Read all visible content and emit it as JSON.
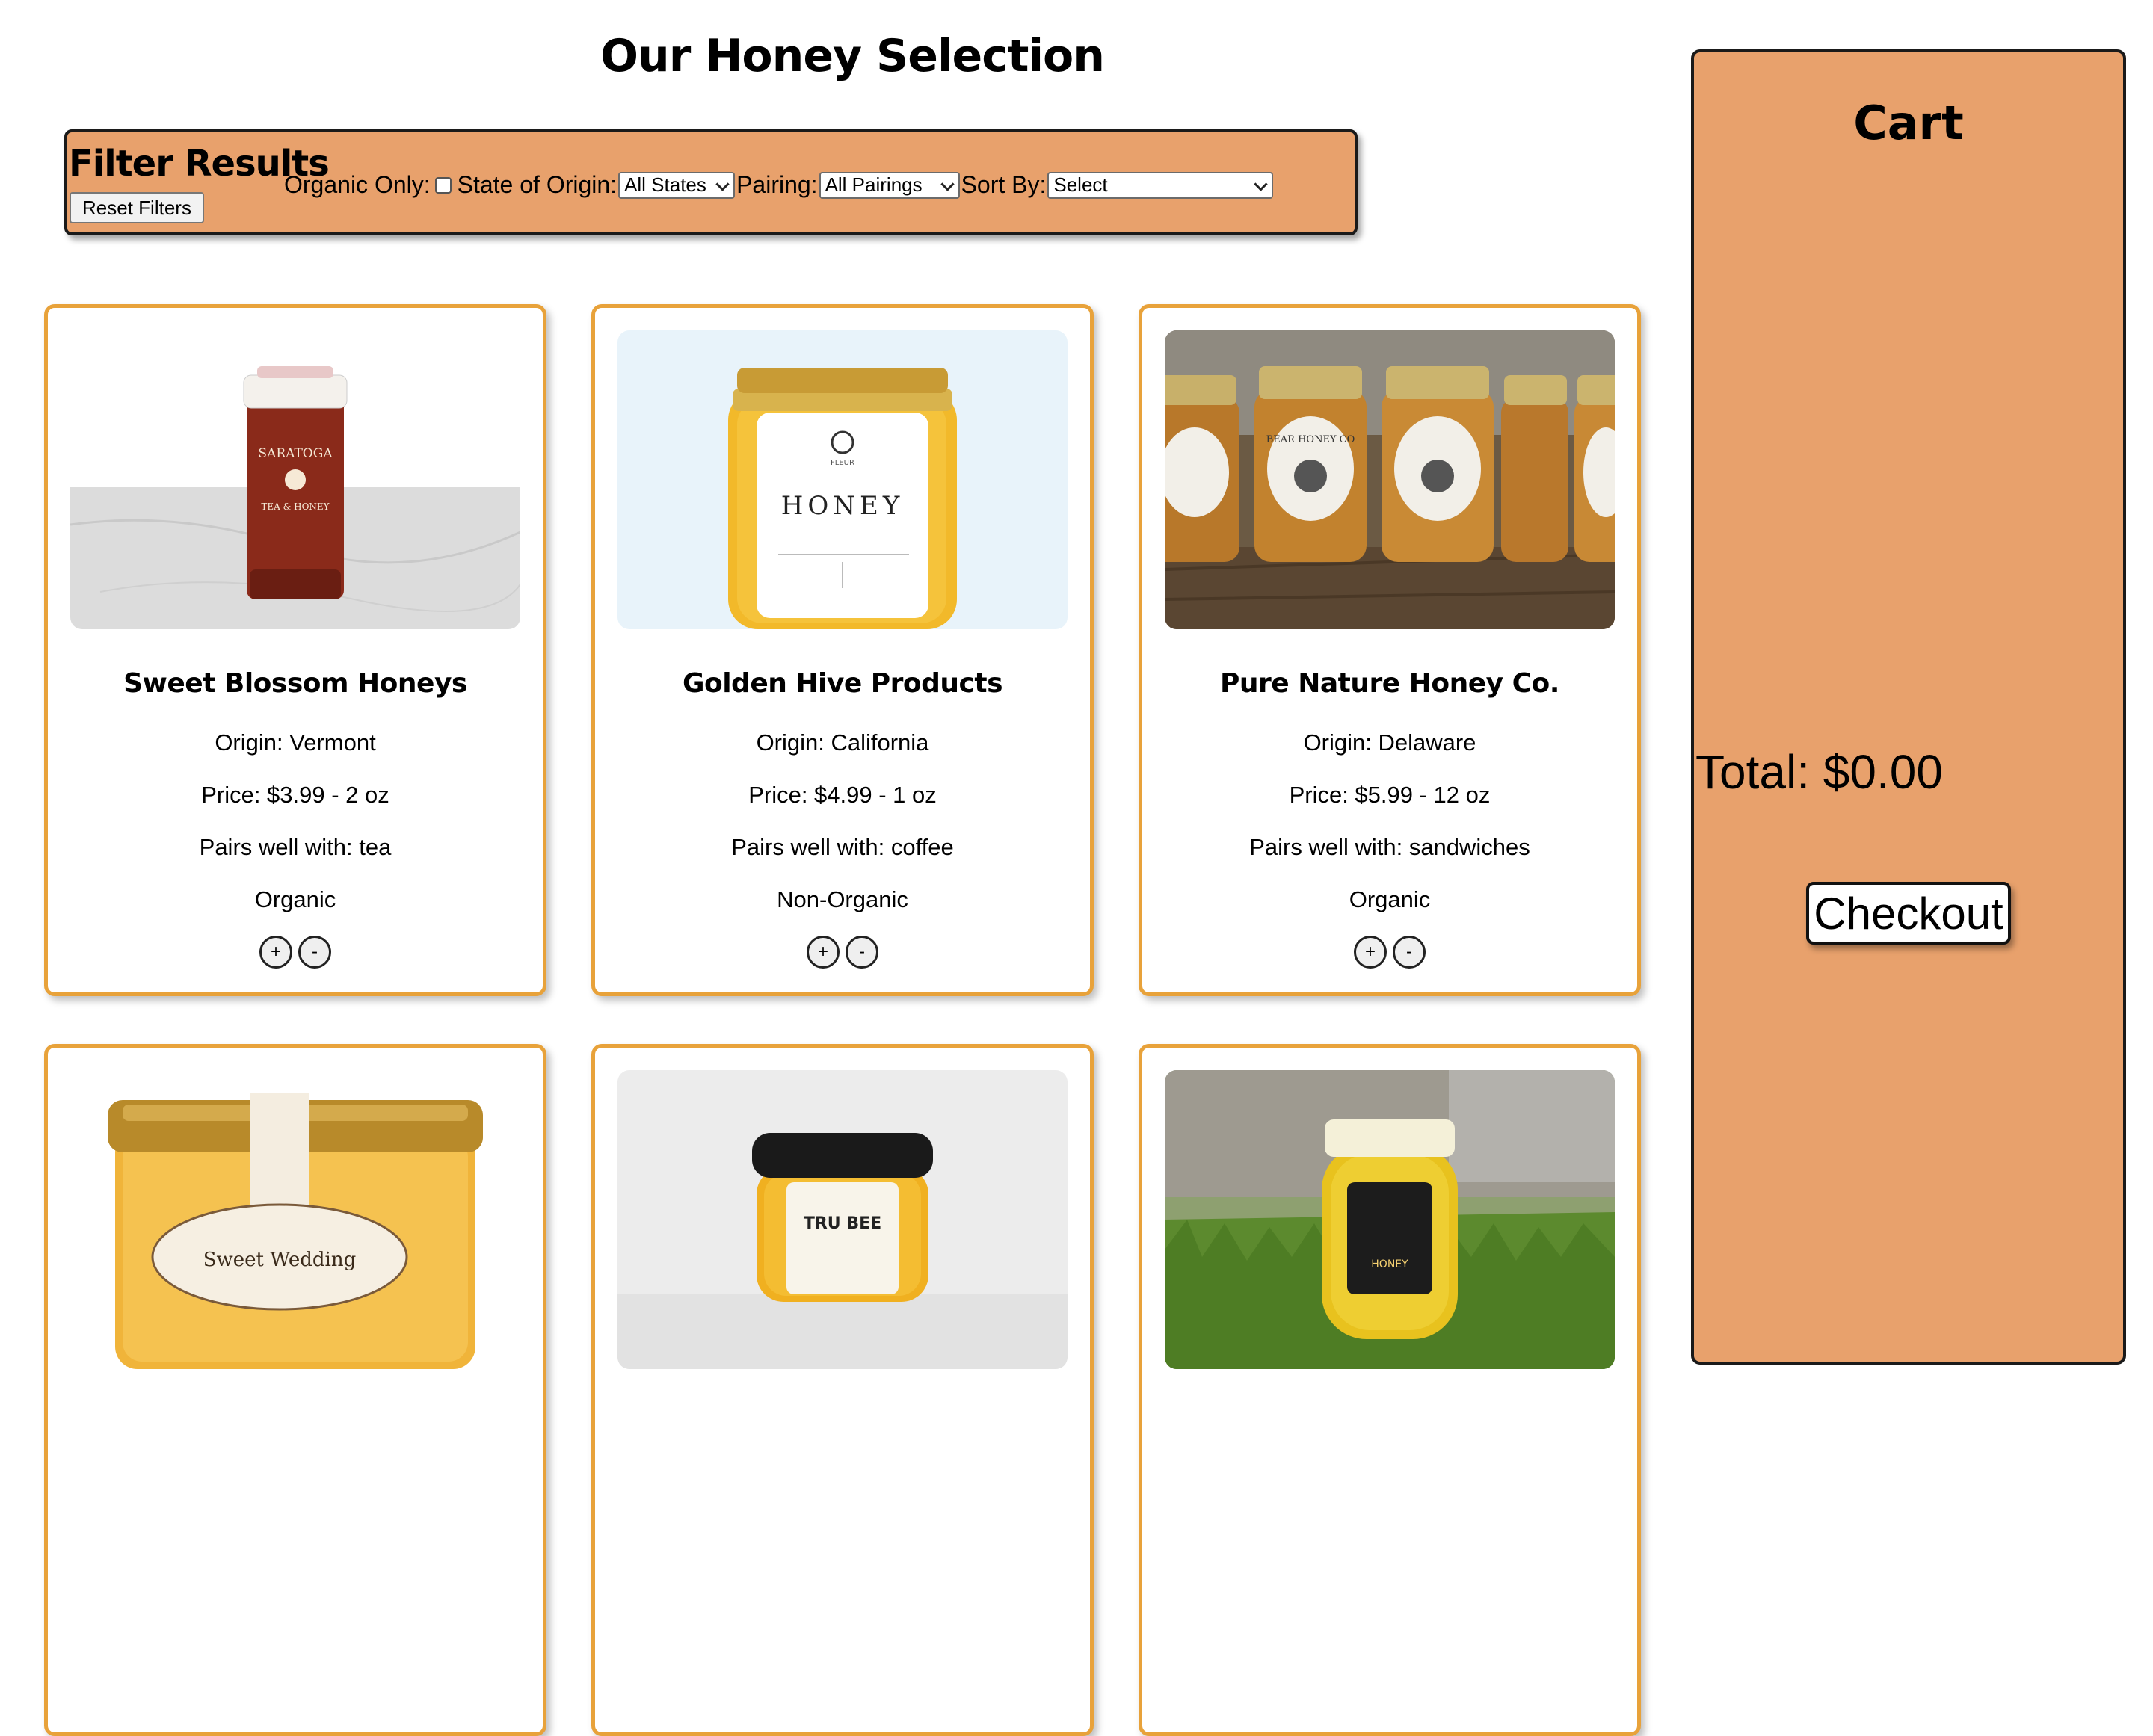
{
  "page_title": "Our Honey Selection",
  "filter": {
    "heading": "Filter Results",
    "organic_label": "Organic Only:",
    "organic_checked": false,
    "state_label": "State of Origin:",
    "state_value": "All States",
    "pairing_label": "Pairing:",
    "pairing_value": "All Pairings",
    "sort_label": "Sort By:",
    "sort_value": "Select",
    "reset_label": "Reset Filters"
  },
  "products": [
    {
      "name": "Sweet Blossom Honeys",
      "origin": "Origin: Vermont",
      "price": "Price: $3.99 - 2 oz",
      "pairs": "Pairs well with: tea",
      "organic": "Organic"
    },
    {
      "name": "Golden Hive Products",
      "origin": "Origin: California",
      "price": "Price: $4.99 - 1 oz",
      "pairs": "Pairs well with: coffee",
      "organic": "Non-Organic"
    },
    {
      "name": "Pure Nature Honey Co.",
      "origin": "Origin: Delaware",
      "price": "Price: $5.99 - 12 oz",
      "pairs": "Pairs well with: sandwiches",
      "organic": "Organic"
    },
    {
      "name": "",
      "origin": "",
      "price": "",
      "pairs": "",
      "organic": ""
    },
    {
      "name": "",
      "origin": "",
      "price": "",
      "pairs": "",
      "organic": ""
    },
    {
      "name": "",
      "origin": "",
      "price": "",
      "pairs": "",
      "organic": ""
    }
  ],
  "qty_buttons": {
    "plus": "+",
    "minus": "-"
  },
  "image_labels": {
    "jar1_brand": "SARATOGA",
    "jar1_sub": "TEA & HONEY",
    "jar2_brand": "FLEUR",
    "jar2_main": "HONEY",
    "jar3_brand": "BEAR HONEY CO",
    "jar4_main": "Sweet Wedding",
    "jar5_main": "TRU BEE",
    "jar6_main": "HONEY"
  },
  "cart": {
    "title": "Cart",
    "total": "Total: $0.00",
    "checkout_label": "Checkout"
  },
  "colors": {
    "accent_orange": "#e8a16c",
    "card_border": "#e8a23a"
  }
}
